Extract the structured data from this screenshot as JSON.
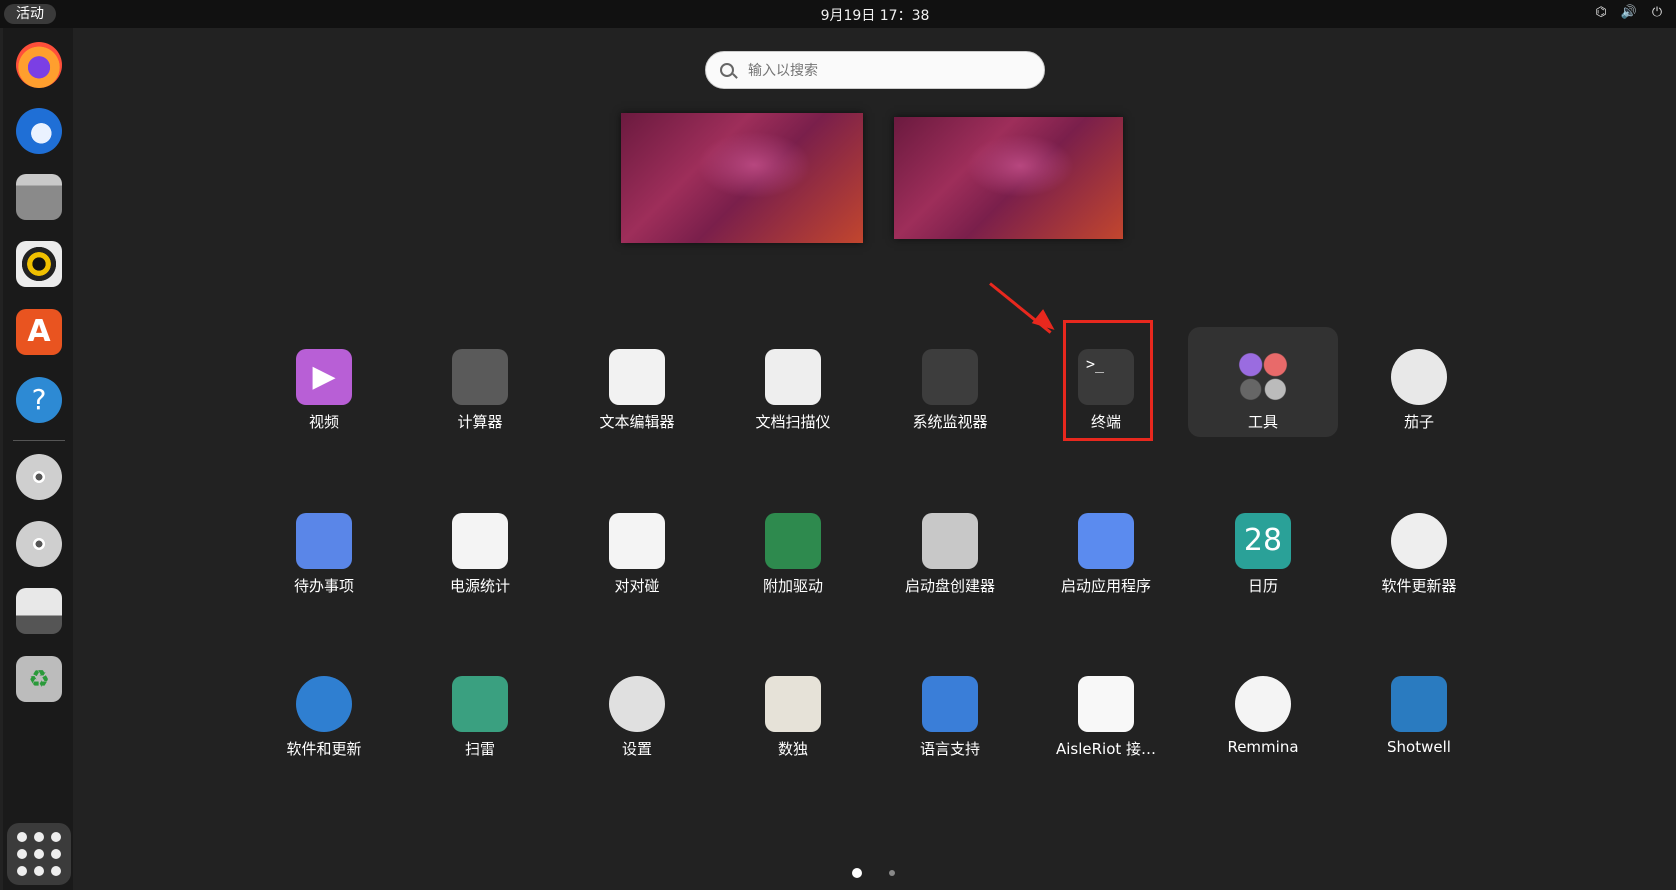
{
  "topbar": {
    "activities": "活动",
    "clock": "9月19日  17：38"
  },
  "search": {
    "placeholder": "输入以搜索"
  },
  "apps": [
    {
      "label": "视频",
      "icon": "video-icon",
      "color": "#b85fd6"
    },
    {
      "label": "计算器",
      "icon": "calculator-icon",
      "color": "#5a5a5a"
    },
    {
      "label": "文本编辑器",
      "icon": "text-editor-icon",
      "color": "#f2f2f2"
    },
    {
      "label": "文档扫描仪",
      "icon": "document-scanner-icon",
      "color": "#eeeeee"
    },
    {
      "label": "系统监视器",
      "icon": "system-monitor-icon",
      "color": "#3d3d3d"
    },
    {
      "label": "终端",
      "icon": "terminal-icon",
      "color": "#3a3a3a"
    },
    {
      "label": "工具",
      "icon": "utilities-folder-icon",
      "color": "#323232"
    },
    {
      "label": "茄子",
      "icon": "cheese-icon",
      "color": "#e8e8e8"
    },
    {
      "label": "待办事项",
      "icon": "todo-icon",
      "color": "#5a86e8"
    },
    {
      "label": "电源统计",
      "icon": "power-statistics-icon",
      "color": "#f4f4f4"
    },
    {
      "label": "对对碰",
      "icon": "mahjongg-icon",
      "color": "#f4f4f4"
    },
    {
      "label": "附加驱动",
      "icon": "additional-drivers-icon",
      "color": "#2e8a4e"
    },
    {
      "label": "启动盘创建器",
      "icon": "startup-disk-creator-icon",
      "color": "#c8c8c8"
    },
    {
      "label": "启动应用程序",
      "icon": "startup-applications-icon",
      "color": "#5b8bef"
    },
    {
      "label": "日历",
      "icon": "calendar-icon",
      "color": "#2aa198"
    },
    {
      "label": "软件更新器",
      "icon": "software-updater-icon",
      "color": "#eeeeee"
    },
    {
      "label": "软件和更新",
      "icon": "software-properties-icon",
      "color": "#2f7fd1"
    },
    {
      "label": "扫雷",
      "icon": "mines-icon",
      "color": "#3aa080"
    },
    {
      "label": "设置",
      "icon": "settings-icon",
      "color": "#e0e0e0"
    },
    {
      "label": "数独",
      "icon": "sudoku-icon",
      "color": "#e6e2d8"
    },
    {
      "label": "语言支持",
      "icon": "language-support-icon",
      "color": "#3a7ed8"
    },
    {
      "label": "AisleRiot 接…",
      "icon": "aisleriot-icon",
      "color": "#f8f8f8"
    },
    {
      "label": "Remmina",
      "icon": "remmina-icon",
      "color": "#f4f4f4"
    },
    {
      "label": "Shotwell",
      "icon": "shotwell-icon",
      "color": "#2a7bc0"
    }
  ],
  "calendar_day": "28",
  "dock": [
    {
      "icon": "firefox-icon",
      "color": "#ff7139"
    },
    {
      "icon": "thunderbird-icon",
      "color": "#1f6fd6"
    },
    {
      "icon": "files-icon",
      "color": "#8a8a8a"
    },
    {
      "icon": "rhythmbox-icon",
      "color": "#f0d000"
    },
    {
      "icon": "app-center-icon",
      "color": "#e95420"
    },
    {
      "icon": "help-icon",
      "color": "#2d8ad4"
    },
    {
      "icon": "disc-icon",
      "color": "#c8c8c8"
    },
    {
      "icon": "disc-icon",
      "color": "#c8c8c8"
    },
    {
      "icon": "floppy-drive-icon",
      "color": "#d0d0d0"
    },
    {
      "icon": "trash-icon",
      "color": "#bcbcbc"
    }
  ]
}
